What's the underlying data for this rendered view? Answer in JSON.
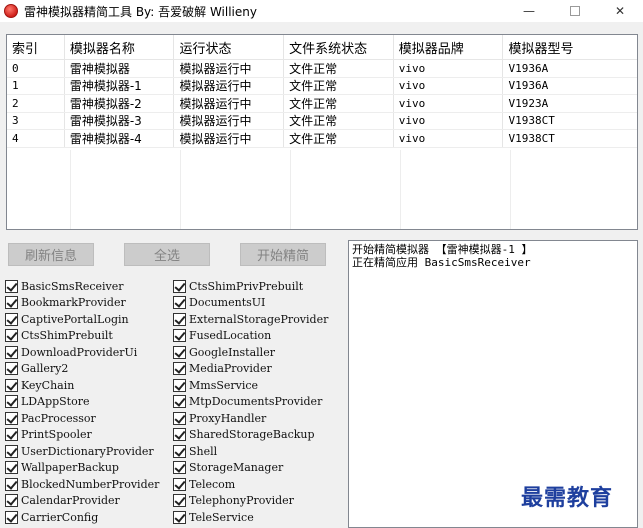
{
  "window": {
    "title": "雷神模拟器精简工具 By: 吾爱破解 Willieny",
    "minimize_glyph": "—",
    "close_glyph": "✕"
  },
  "table": {
    "headers": [
      "索引",
      "模拟器名称",
      "运行状态",
      "文件系统状态",
      "模拟器品牌",
      "模拟器型号"
    ],
    "rows": [
      [
        "0",
        "雷神模拟器",
        "模拟器运行中",
        "文件正常",
        "vivo",
        "V1936A"
      ],
      [
        "1",
        "雷神模拟器-1",
        "模拟器运行中",
        "文件正常",
        "vivo",
        "V1936A"
      ],
      [
        "2",
        "雷神模拟器-2",
        "模拟器运行中",
        "文件正常",
        "vivo",
        "V1923A"
      ],
      [
        "3",
        "雷神模拟器-3",
        "模拟器运行中",
        "文件正常",
        "vivo",
        "V1938CT"
      ],
      [
        "4",
        "雷神模拟器-4",
        "模拟器运行中",
        "文件正常",
        "vivo",
        "V1938CT"
      ]
    ]
  },
  "buttons": {
    "refresh": "刷新信息",
    "select_all": "全选",
    "start": "开始精简"
  },
  "apps_left": [
    "BasicSmsReceiver",
    "BookmarkProvider",
    "CaptivePortalLogin",
    "CtsShimPrebuilt",
    "DownloadProviderUi",
    "Gallery2",
    "KeyChain",
    "LDAppStore",
    "PacProcessor",
    "PrintSpooler",
    "UserDictionaryProvider",
    "WallpaperBackup",
    "BlockedNumberProvider",
    "CalendarProvider",
    "CarrierConfig"
  ],
  "apps_right": [
    "CtsShimPrivPrebuilt",
    "DocumentsUI",
    "ExternalStorageProvider",
    "FusedLocation",
    "GoogleInstaller",
    "MediaProvider",
    "MmsService",
    "MtpDocumentsProvider",
    "ProxyHandler",
    "SharedStorageBackup",
    "Shell",
    "StorageManager",
    "Telecom",
    "TelephonyProvider",
    "TeleService"
  ],
  "log": {
    "lines": [
      "开始精简模拟器 【雷神模拟器-1 】",
      "正在精简应用 BasicSmsReceiver"
    ]
  },
  "watermark": "最需教育"
}
